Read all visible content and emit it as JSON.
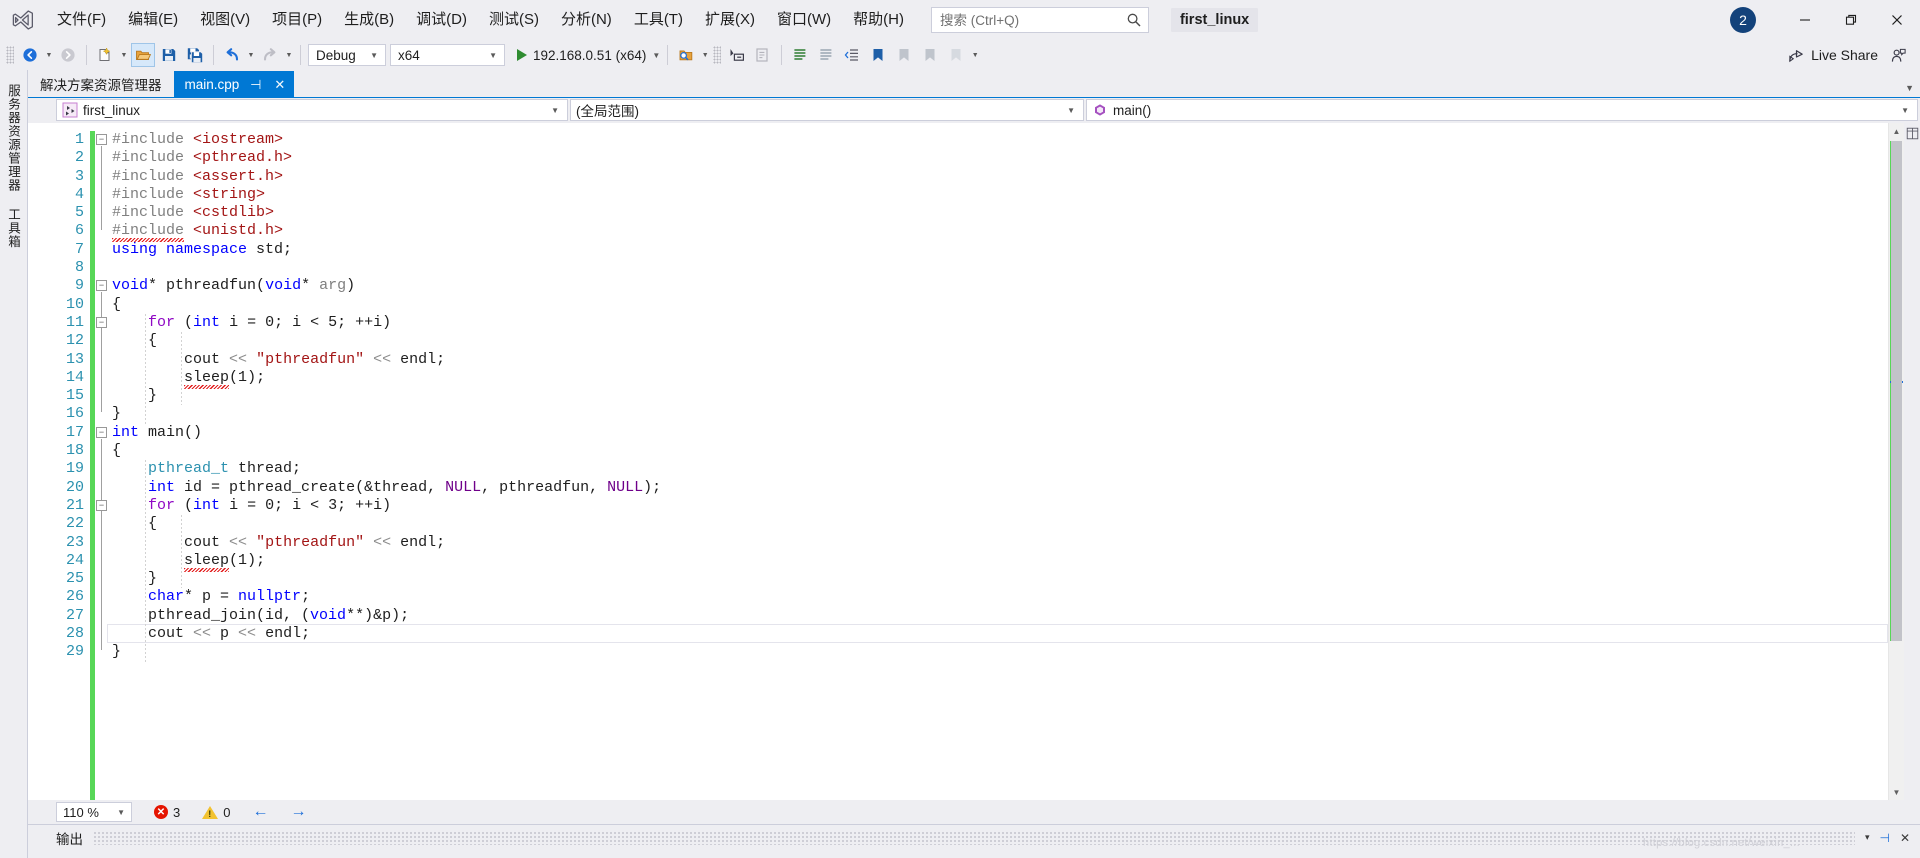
{
  "titlebar": {
    "logo_icon": "visual-studio-logo",
    "menus": [
      {
        "label": "文件(F)"
      },
      {
        "label": "编辑(E)"
      },
      {
        "label": "视图(V)"
      },
      {
        "label": "项目(P)"
      },
      {
        "label": "生成(B)"
      },
      {
        "label": "调试(D)"
      },
      {
        "label": "测试(S)"
      },
      {
        "label": "分析(N)"
      },
      {
        "label": "工具(T)"
      },
      {
        "label": "扩展(X)"
      },
      {
        "label": "窗口(W)"
      },
      {
        "label": "帮助(H)"
      }
    ],
    "search": {
      "placeholder": "搜索 (Ctrl+Q)",
      "value": "",
      "icon": "search-icon"
    },
    "solution_name": "first_linux",
    "notification_count": "2",
    "minimize": "—",
    "maximize": "❐",
    "close": "✕"
  },
  "toolbar": {
    "navigate_back": "navigate-back-icon",
    "navigate_forward": "navigate-forward-icon",
    "new_item": "new-item-icon",
    "open_file": "open-file-icon",
    "save": "save-icon",
    "save_all": "save-all-icon",
    "undo": "undo-icon",
    "redo": "redo-icon",
    "config_label": "Debug",
    "platform_label": "x64",
    "run_target": "192.168.0.51 (x64)",
    "live_share_label": "Live Share"
  },
  "leftdock": {
    "tabs": [
      {
        "label": "服务器资源管理器",
        "name": "server-explorer"
      },
      {
        "label": "工具箱",
        "name": "toolbox"
      }
    ]
  },
  "tabs": {
    "solution_explorer": "解决方案资源管理器",
    "active_file": "main.cpp",
    "pin_glyph": "⊣",
    "close_glyph": "✕"
  },
  "navbar": {
    "project": "first_linux",
    "scope": "(全局范围)",
    "member": "main()",
    "project_icon": "cpp-project-icon",
    "member_icon": "method-icon"
  },
  "editor": {
    "current_line": 28,
    "lines": [
      {
        "n": 1,
        "tokens": [
          {
            "t": "#include ",
            "c": "pp"
          },
          {
            "t": "<iostream>",
            "c": "inc"
          }
        ]
      },
      {
        "n": 2,
        "tokens": [
          {
            "t": "#include ",
            "c": "pp"
          },
          {
            "t": "<pthread.h>",
            "c": "inc"
          }
        ]
      },
      {
        "n": 3,
        "tokens": [
          {
            "t": "#include ",
            "c": "pp"
          },
          {
            "t": "<assert.h>",
            "c": "inc"
          }
        ]
      },
      {
        "n": 4,
        "tokens": [
          {
            "t": "#include ",
            "c": "pp"
          },
          {
            "t": "<string>",
            "c": "inc"
          }
        ]
      },
      {
        "n": 5,
        "tokens": [
          {
            "t": "#include ",
            "c": "pp"
          },
          {
            "t": "<cstdlib>",
            "c": "inc"
          }
        ]
      },
      {
        "n": 6,
        "tokens": [
          {
            "t": "#include",
            "c": "pp",
            "squig": true
          },
          {
            "t": " ",
            "c": "pp"
          },
          {
            "t": "<unistd.h>",
            "c": "inc"
          }
        ]
      },
      {
        "n": 7,
        "tokens": [
          {
            "t": "using namespace",
            "c": "k"
          },
          {
            "t": " std;",
            "c": "fn"
          }
        ]
      },
      {
        "n": 8,
        "tokens": []
      },
      {
        "n": 9,
        "tokens": [
          {
            "t": "void",
            "c": "k"
          },
          {
            "t": "* ",
            "c": "fn"
          },
          {
            "t": "pthreadfun",
            "c": "fn"
          },
          {
            "t": "(",
            "c": "fn"
          },
          {
            "t": "void",
            "c": "k"
          },
          {
            "t": "* ",
            "c": "fn"
          },
          {
            "t": "arg",
            "c": "pa"
          },
          {
            "t": ")",
            "c": "fn"
          }
        ]
      },
      {
        "n": 10,
        "tokens": [
          {
            "t": "{",
            "c": "fn"
          }
        ]
      },
      {
        "n": 11,
        "tokens": [
          {
            "t": "    ",
            "c": "fn"
          },
          {
            "t": "for",
            "c": "kc"
          },
          {
            "t": " (",
            "c": "fn"
          },
          {
            "t": "int",
            "c": "k"
          },
          {
            "t": " i = ",
            "c": "fn"
          },
          {
            "t": "0",
            "c": "num"
          },
          {
            "t": "; i ",
            "c": "fn"
          },
          {
            "t": "<",
            "c": "fn"
          },
          {
            "t": " ",
            "c": "fn"
          },
          {
            "t": "5",
            "c": "num"
          },
          {
            "t": "; ++i)",
            "c": "fn"
          }
        ]
      },
      {
        "n": 12,
        "tokens": [
          {
            "t": "    {",
            "c": "fn"
          }
        ]
      },
      {
        "n": 13,
        "tokens": [
          {
            "t": "        cout ",
            "c": "fn"
          },
          {
            "t": "<<",
            "c": "op"
          },
          {
            "t": " ",
            "c": "fn"
          },
          {
            "t": "\"pthreadfun\"",
            "c": "str"
          },
          {
            "t": " ",
            "c": "fn"
          },
          {
            "t": "<<",
            "c": "op"
          },
          {
            "t": " endl;",
            "c": "fn"
          }
        ]
      },
      {
        "n": 14,
        "tokens": [
          {
            "t": "        ",
            "c": "fn"
          },
          {
            "t": "sleep",
            "c": "fn",
            "squig": true
          },
          {
            "t": "(",
            "c": "fn"
          },
          {
            "t": "1",
            "c": "num"
          },
          {
            "t": ");",
            "c": "fn"
          }
        ]
      },
      {
        "n": 15,
        "tokens": [
          {
            "t": "    }",
            "c": "fn"
          }
        ]
      },
      {
        "n": 16,
        "tokens": [
          {
            "t": "}",
            "c": "fn"
          }
        ]
      },
      {
        "n": 17,
        "tokens": [
          {
            "t": "int",
            "c": "k"
          },
          {
            "t": " ",
            "c": "fn"
          },
          {
            "t": "main",
            "c": "fn"
          },
          {
            "t": "()",
            "c": "fn"
          }
        ]
      },
      {
        "n": 18,
        "tokens": [
          {
            "t": "{",
            "c": "fn"
          }
        ]
      },
      {
        "n": 19,
        "tokens": [
          {
            "t": "    ",
            "c": "fn"
          },
          {
            "t": "pthread_t",
            "c": "ty"
          },
          {
            "t": " thread;",
            "c": "fn"
          }
        ]
      },
      {
        "n": 20,
        "tokens": [
          {
            "t": "    ",
            "c": "fn"
          },
          {
            "t": "int",
            "c": "k"
          },
          {
            "t": " id = ",
            "c": "fn"
          },
          {
            "t": "pthread_create",
            "c": "fn"
          },
          {
            "t": "(&thread, ",
            "c": "fn"
          },
          {
            "t": "NULL",
            "c": "mac"
          },
          {
            "t": ", pthreadfun, ",
            "c": "fn"
          },
          {
            "t": "NULL",
            "c": "mac"
          },
          {
            "t": ");",
            "c": "fn"
          }
        ]
      },
      {
        "n": 21,
        "tokens": [
          {
            "t": "    ",
            "c": "fn"
          },
          {
            "t": "for",
            "c": "kc"
          },
          {
            "t": " (",
            "c": "fn"
          },
          {
            "t": "int",
            "c": "k"
          },
          {
            "t": " i = ",
            "c": "fn"
          },
          {
            "t": "0",
            "c": "num"
          },
          {
            "t": "; i ",
            "c": "fn"
          },
          {
            "t": "<",
            "c": "fn"
          },
          {
            "t": " ",
            "c": "fn"
          },
          {
            "t": "3",
            "c": "num"
          },
          {
            "t": "; ++i)",
            "c": "fn"
          }
        ]
      },
      {
        "n": 22,
        "tokens": [
          {
            "t": "    {",
            "c": "fn"
          }
        ]
      },
      {
        "n": 23,
        "tokens": [
          {
            "t": "        cout ",
            "c": "fn"
          },
          {
            "t": "<<",
            "c": "op"
          },
          {
            "t": " ",
            "c": "fn"
          },
          {
            "t": "\"pthreadfun\"",
            "c": "str"
          },
          {
            "t": " ",
            "c": "fn"
          },
          {
            "t": "<<",
            "c": "op"
          },
          {
            "t": " endl;",
            "c": "fn"
          }
        ]
      },
      {
        "n": 24,
        "tokens": [
          {
            "t": "        ",
            "c": "fn"
          },
          {
            "t": "sleep",
            "c": "fn",
            "squig": true
          },
          {
            "t": "(",
            "c": "fn"
          },
          {
            "t": "1",
            "c": "num"
          },
          {
            "t": ");",
            "c": "fn"
          }
        ]
      },
      {
        "n": 25,
        "tokens": [
          {
            "t": "    }",
            "c": "fn"
          }
        ]
      },
      {
        "n": 26,
        "tokens": [
          {
            "t": "    ",
            "c": "fn"
          },
          {
            "t": "char",
            "c": "k"
          },
          {
            "t": "* p = ",
            "c": "fn"
          },
          {
            "t": "nullptr",
            "c": "k"
          },
          {
            "t": ";",
            "c": "fn"
          }
        ]
      },
      {
        "n": 27,
        "tokens": [
          {
            "t": "    pthread_join(id, (",
            "c": "fn"
          },
          {
            "t": "void",
            "c": "k"
          },
          {
            "t": "**)&p);",
            "c": "fn"
          }
        ]
      },
      {
        "n": 28,
        "tokens": [
          {
            "t": "    cout ",
            "c": "fn"
          },
          {
            "t": "<<",
            "c": "op"
          },
          {
            "t": " p ",
            "c": "fn"
          },
          {
            "t": "<<",
            "c": "op"
          },
          {
            "t": " endl;",
            "c": "fn"
          }
        ]
      },
      {
        "n": 29,
        "tokens": [
          {
            "t": "}",
            "c": "fn"
          }
        ]
      }
    ]
  },
  "status": {
    "zoom": "110 %",
    "error_count": "3",
    "warning_count": "0",
    "prev_glyph": "←",
    "next_glyph": "→"
  },
  "output": {
    "title": "输出",
    "watermark": "https://blog.csdn.net/weixin_...",
    "dropdown_glyph": "▾",
    "pin_glyph": "⊣",
    "close_glyph": "✕"
  }
}
